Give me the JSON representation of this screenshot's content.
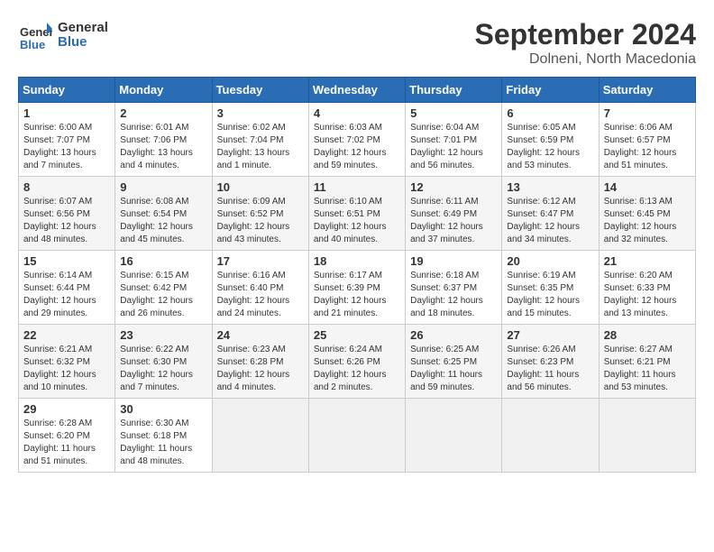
{
  "header": {
    "logo_line1": "General",
    "logo_line2": "Blue",
    "month": "September 2024",
    "location": "Dolneni, North Macedonia"
  },
  "columns": [
    "Sunday",
    "Monday",
    "Tuesday",
    "Wednesday",
    "Thursday",
    "Friday",
    "Saturday"
  ],
  "weeks": [
    [
      {
        "day": "1",
        "info": "Sunrise: 6:00 AM\nSunset: 7:07 PM\nDaylight: 13 hours\nand 7 minutes."
      },
      {
        "day": "2",
        "info": "Sunrise: 6:01 AM\nSunset: 7:06 PM\nDaylight: 13 hours\nand 4 minutes."
      },
      {
        "day": "3",
        "info": "Sunrise: 6:02 AM\nSunset: 7:04 PM\nDaylight: 13 hours\nand 1 minute."
      },
      {
        "day": "4",
        "info": "Sunrise: 6:03 AM\nSunset: 7:02 PM\nDaylight: 12 hours\nand 59 minutes."
      },
      {
        "day": "5",
        "info": "Sunrise: 6:04 AM\nSunset: 7:01 PM\nDaylight: 12 hours\nand 56 minutes."
      },
      {
        "day": "6",
        "info": "Sunrise: 6:05 AM\nSunset: 6:59 PM\nDaylight: 12 hours\nand 53 minutes."
      },
      {
        "day": "7",
        "info": "Sunrise: 6:06 AM\nSunset: 6:57 PM\nDaylight: 12 hours\nand 51 minutes."
      }
    ],
    [
      {
        "day": "8",
        "info": "Sunrise: 6:07 AM\nSunset: 6:56 PM\nDaylight: 12 hours\nand 48 minutes."
      },
      {
        "day": "9",
        "info": "Sunrise: 6:08 AM\nSunset: 6:54 PM\nDaylight: 12 hours\nand 45 minutes."
      },
      {
        "day": "10",
        "info": "Sunrise: 6:09 AM\nSunset: 6:52 PM\nDaylight: 12 hours\nand 43 minutes."
      },
      {
        "day": "11",
        "info": "Sunrise: 6:10 AM\nSunset: 6:51 PM\nDaylight: 12 hours\nand 40 minutes."
      },
      {
        "day": "12",
        "info": "Sunrise: 6:11 AM\nSunset: 6:49 PM\nDaylight: 12 hours\nand 37 minutes."
      },
      {
        "day": "13",
        "info": "Sunrise: 6:12 AM\nSunset: 6:47 PM\nDaylight: 12 hours\nand 34 minutes."
      },
      {
        "day": "14",
        "info": "Sunrise: 6:13 AM\nSunset: 6:45 PM\nDaylight: 12 hours\nand 32 minutes."
      }
    ],
    [
      {
        "day": "15",
        "info": "Sunrise: 6:14 AM\nSunset: 6:44 PM\nDaylight: 12 hours\nand 29 minutes."
      },
      {
        "day": "16",
        "info": "Sunrise: 6:15 AM\nSunset: 6:42 PM\nDaylight: 12 hours\nand 26 minutes."
      },
      {
        "day": "17",
        "info": "Sunrise: 6:16 AM\nSunset: 6:40 PM\nDaylight: 12 hours\nand 24 minutes."
      },
      {
        "day": "18",
        "info": "Sunrise: 6:17 AM\nSunset: 6:39 PM\nDaylight: 12 hours\nand 21 minutes."
      },
      {
        "day": "19",
        "info": "Sunrise: 6:18 AM\nSunset: 6:37 PM\nDaylight: 12 hours\nand 18 minutes."
      },
      {
        "day": "20",
        "info": "Sunrise: 6:19 AM\nSunset: 6:35 PM\nDaylight: 12 hours\nand 15 minutes."
      },
      {
        "day": "21",
        "info": "Sunrise: 6:20 AM\nSunset: 6:33 PM\nDaylight: 12 hours\nand 13 minutes."
      }
    ],
    [
      {
        "day": "22",
        "info": "Sunrise: 6:21 AM\nSunset: 6:32 PM\nDaylight: 12 hours\nand 10 minutes."
      },
      {
        "day": "23",
        "info": "Sunrise: 6:22 AM\nSunset: 6:30 PM\nDaylight: 12 hours\nand 7 minutes."
      },
      {
        "day": "24",
        "info": "Sunrise: 6:23 AM\nSunset: 6:28 PM\nDaylight: 12 hours\nand 4 minutes."
      },
      {
        "day": "25",
        "info": "Sunrise: 6:24 AM\nSunset: 6:26 PM\nDaylight: 12 hours\nand 2 minutes."
      },
      {
        "day": "26",
        "info": "Sunrise: 6:25 AM\nSunset: 6:25 PM\nDaylight: 11 hours\nand 59 minutes."
      },
      {
        "day": "27",
        "info": "Sunrise: 6:26 AM\nSunset: 6:23 PM\nDaylight: 11 hours\nand 56 minutes."
      },
      {
        "day": "28",
        "info": "Sunrise: 6:27 AM\nSunset: 6:21 PM\nDaylight: 11 hours\nand 53 minutes."
      }
    ],
    [
      {
        "day": "29",
        "info": "Sunrise: 6:28 AM\nSunset: 6:20 PM\nDaylight: 11 hours\nand 51 minutes."
      },
      {
        "day": "30",
        "info": "Sunrise: 6:30 AM\nSunset: 6:18 PM\nDaylight: 11 hours\nand 48 minutes."
      },
      {
        "day": "",
        "info": ""
      },
      {
        "day": "",
        "info": ""
      },
      {
        "day": "",
        "info": ""
      },
      {
        "day": "",
        "info": ""
      },
      {
        "day": "",
        "info": ""
      }
    ]
  ]
}
